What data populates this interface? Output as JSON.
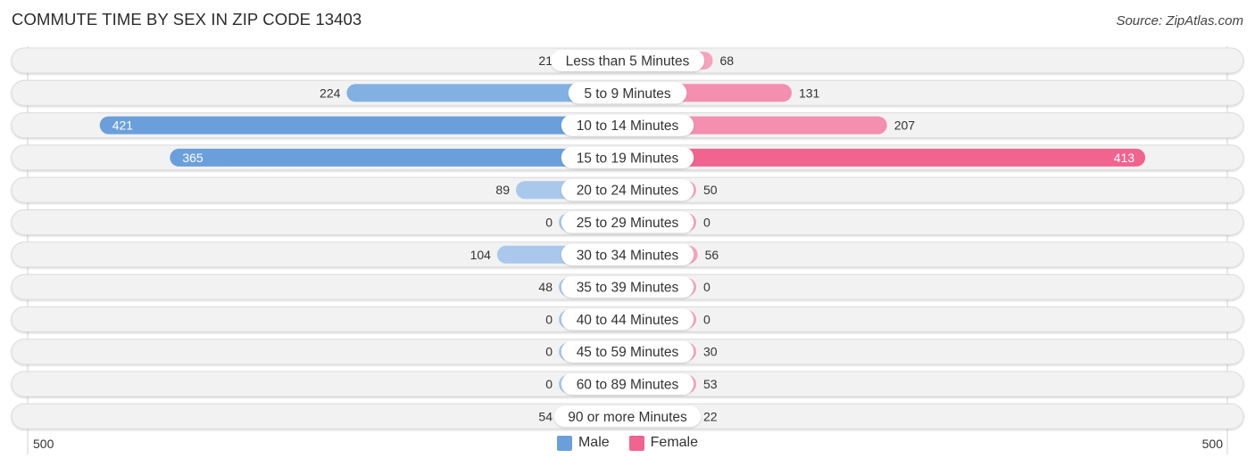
{
  "header": {
    "title": "COMMUTE TIME BY SEX IN ZIP CODE 13403",
    "source": "Source: ZipAtlas.com"
  },
  "colors": {
    "male": "#6a9fdb",
    "male_light": "#a9c8eb",
    "female": "#f0648f",
    "female_light": "#f6a3bc",
    "track": "#f2f2f2"
  },
  "chart_data": {
    "type": "bar",
    "orientation": "horizontal-diverging",
    "title": "COMMUTE TIME BY SEX IN ZIP CODE 13403",
    "categories": [
      "Less than 5 Minutes",
      "5 to 9 Minutes",
      "10 to 14 Minutes",
      "15 to 19 Minutes",
      "20 to 24 Minutes",
      "25 to 29 Minutes",
      "30 to 34 Minutes",
      "35 to 39 Minutes",
      "40 to 44 Minutes",
      "45 to 59 Minutes",
      "60 to 89 Minutes",
      "90 or more Minutes"
    ],
    "series": [
      {
        "name": "Male",
        "values": [
          21,
          224,
          421,
          365,
          89,
          0,
          104,
          48,
          0,
          0,
          0,
          54
        ]
      },
      {
        "name": "Female",
        "values": [
          68,
          131,
          207,
          413,
          50,
          0,
          56,
          0,
          0,
          30,
          53,
          22
        ]
      }
    ],
    "xlim": [
      -500,
      500
    ],
    "axis_labels": {
      "left": "500",
      "right": "500"
    },
    "legend": {
      "position": "bottom-center",
      "entries": [
        "Male",
        "Female"
      ]
    },
    "grid": false
  }
}
